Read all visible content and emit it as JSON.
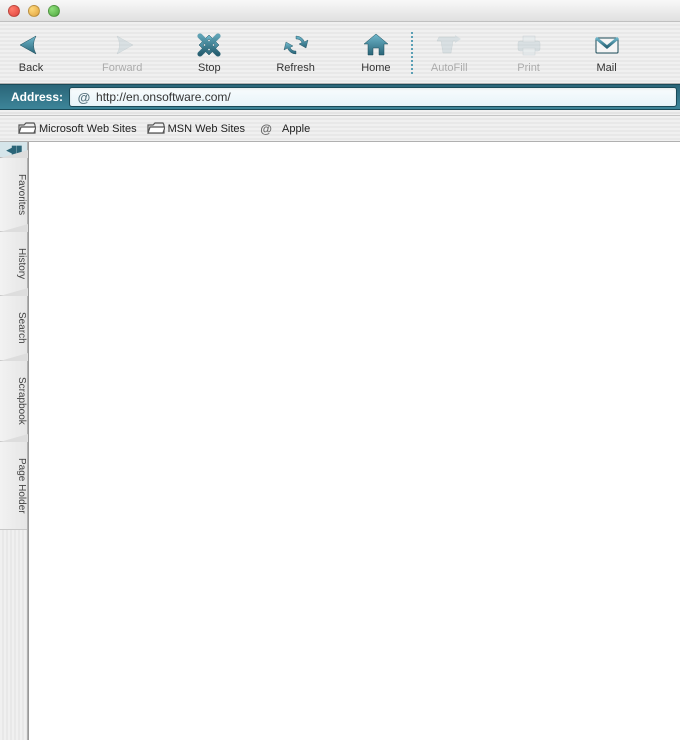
{
  "titlebar": {
    "buttons": [
      "close",
      "minimize",
      "zoom"
    ]
  },
  "toolbar": {
    "back": {
      "label": "Back",
      "enabled": true
    },
    "forward": {
      "label": "Forward",
      "enabled": false
    },
    "stop": {
      "label": "Stop",
      "enabled": true
    },
    "refresh": {
      "label": "Refresh",
      "enabled": true
    },
    "home": {
      "label": "Home",
      "enabled": true
    },
    "autofill": {
      "label": "AutoFill",
      "enabled": false
    },
    "print": {
      "label": "Print",
      "enabled": false
    },
    "mail": {
      "label": "Mail",
      "enabled": true
    }
  },
  "addressbar": {
    "label": "Address:",
    "url": "http://en.onsoftware.com/"
  },
  "bookmarks": {
    "items": [
      {
        "label": "Microsoft Web Sites",
        "icon": "folder"
      },
      {
        "label": "MSN Web Sites",
        "icon": "folder"
      },
      {
        "label": "Apple",
        "icon": "at"
      }
    ]
  },
  "sidebar": {
    "tabs": [
      {
        "label": "Favorites"
      },
      {
        "label": "History"
      },
      {
        "label": "Search"
      },
      {
        "label": "Scrapbook"
      },
      {
        "label": "Page Holder"
      }
    ]
  },
  "colors": {
    "accent": "#2a6578",
    "accentLight": "#3d8599",
    "iconTeal": "#3a7d94"
  }
}
